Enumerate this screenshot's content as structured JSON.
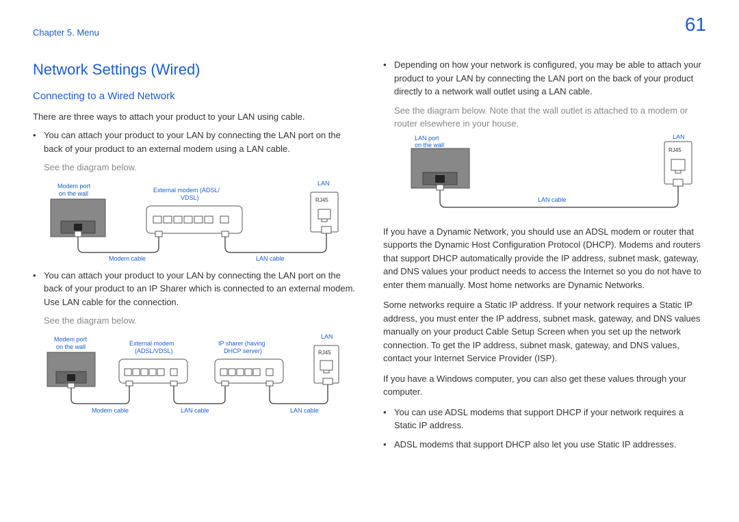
{
  "header": {
    "chapter": "Chapter 5. Menu",
    "page_number": "61"
  },
  "left": {
    "h1": "Network Settings (Wired)",
    "h2": "Connecting to a Wired Network",
    "intro": "There are three ways to attach your product to your LAN using cable.",
    "bullet1": "You can attach your product to your LAN by connecting the LAN port on the back of your product to an external modem using a LAN cable.",
    "see1": "See the diagram below.",
    "bullet2": "You can attach your product to your LAN by connecting the LAN port on the back of your product to an IP Sharer which is connected to an external modem. Use LAN cable for the connection.",
    "see2": "See the diagram below.",
    "diagram1": {
      "modem_port": "Modem port",
      "on_wall": "on the wall",
      "ext_modem": "External modem (ADSL/",
      "vdsl": "VDSL)",
      "lan": "LAN",
      "rj45": "RJ45",
      "modem_cable": "Modem cable",
      "lan_cable": "LAN cable"
    },
    "diagram2": {
      "modem_port": "Modem port",
      "on_wall": "on the wall",
      "ext_modem": "External modem",
      "adsl_vdsl": "(ADSL/VDSL)",
      "ip_sharer": "IP sharer (having",
      "dhcp": "DHCP server)",
      "lan": "LAN",
      "rj45": "RJ45",
      "modem_cable": "Modem cable",
      "lan_cable": "LAN cable",
      "lan_cable2": "LAN cable"
    }
  },
  "right": {
    "bullet1": "Depending on how your network is configured, you may be able to attach your product to your LAN by connecting the LAN port on the back of your product directly to a network wall outlet using a LAN cable.",
    "see1": "See the diagram below. Note that the wall outlet is attached to a modem or router elsewhere in your house.",
    "diagram3": {
      "lan_port": "LAN port",
      "on_wall": "on the wall",
      "lan": "LAN",
      "rj45": "RJ45",
      "lan_cable": "LAN cable"
    },
    "para1": "If you have a Dynamic Network, you should use an ADSL modem or router that supports the Dynamic Host Configuration Protocol (DHCP). Modems and routers that support DHCP automatically provide the IP address, subnet mask, gateway, and DNS values your product needs to access the Internet so you do not have to enter them manually. Most home networks are Dynamic Networks.",
    "para2": "Some networks require a Static IP address. If your network requires a Static IP address, you must enter the IP address, subnet mask, gateway, and DNS values manually on your product Cable Setup Screen when you set up the network connection. To get the IP address, subnet mask, gateway, and DNS values, contact your Internet Service Provider (ISP).",
    "para3": "If you have a Windows computer, you can also get these values through your computer.",
    "bullet2": "You can use ADSL modems that support DHCP if your network requires a Static IP address.",
    "bullet3": "ADSL modems that support DHCP also let you use Static IP addresses."
  }
}
